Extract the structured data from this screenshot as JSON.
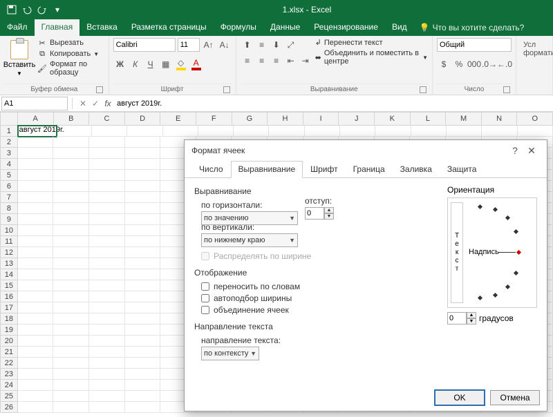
{
  "app": {
    "title": "1.xlsx - Excel"
  },
  "menu": {
    "file": "Файл",
    "home": "Главная",
    "insert": "Вставка",
    "layout": "Разметка страницы",
    "formulas": "Формулы",
    "data": "Данные",
    "review": "Рецензирование",
    "view": "Вид",
    "tellme": "Что вы хотите сделать?"
  },
  "ribbon": {
    "clipboard": {
      "paste": "Вставить",
      "cut": "Вырезать",
      "copy": "Копировать",
      "formatpainter": "Формат по образцу",
      "label": "Буфер обмена"
    },
    "font": {
      "name": "Calibri",
      "size": "11",
      "label": "Шрифт"
    },
    "alignment": {
      "wrap": "Перенести текст",
      "merge": "Объединить и поместить в центре",
      "label": "Выравнивание"
    },
    "number": {
      "format": "Общий",
      "label": "Число"
    },
    "styles": {
      "cond": "Усл формати"
    }
  },
  "formula_bar": {
    "cell_ref": "A1",
    "value": "август 2019г."
  },
  "columns": [
    "A",
    "B",
    "C",
    "D",
    "E",
    "F",
    "G",
    "H",
    "I",
    "J",
    "K",
    "L",
    "M",
    "N",
    "O"
  ],
  "rows_count": 26,
  "cell_a1": "август 2019г.",
  "dialog": {
    "title": "Формат ячеек",
    "tabs": {
      "number": "Число",
      "alignment": "Выравнивание",
      "font": "Шрифт",
      "border": "Граница",
      "fill": "Заливка",
      "protection": "Защита"
    },
    "sect_alignment": "Выравнивание",
    "h_label": "по горизонтали:",
    "h_value": "по значению",
    "indent_label": "отступ:",
    "indent_value": "0",
    "v_label": "по вертикали:",
    "v_value": "по нижнему краю",
    "distribute": "Распределять по ширине",
    "sect_display": "Отображение",
    "wrap": "переносить по словам",
    "shrink": "автоподбор ширины",
    "merge": "объединение ячеек",
    "sect_direction": "Направление текста",
    "dir_label": "направление текста:",
    "dir_value": "по контексту",
    "orientation_title": "Ориентация",
    "orient_text": "Текст",
    "orient_caption": "Надпись",
    "degrees_value": "0",
    "degrees_label": "градусов",
    "ok": "OK",
    "cancel": "Отмена"
  }
}
